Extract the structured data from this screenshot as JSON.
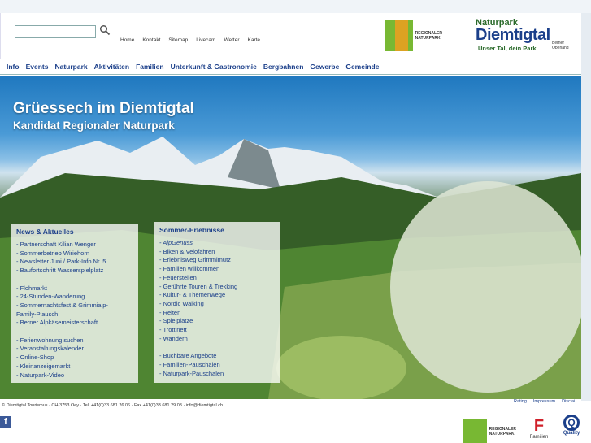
{
  "search": {
    "placeholder": ""
  },
  "topnav": [
    "Home",
    "Kontakt",
    "Sitemap",
    "Livecam",
    "Wetter",
    "Karte"
  ],
  "logos": {
    "regional": [
      "SCHWEIZER",
      "PARKS",
      "REGIONALER",
      "NATURPARK"
    ],
    "diemtigtal": {
      "prefix": "Naturpark",
      "name": "Diemtigtal",
      "tagline": "Unser Tal, dein Park.",
      "region": "Berner Oberland"
    },
    "familien": {
      "letter": "F",
      "label": "Familien"
    },
    "quality": {
      "letter": "Q",
      "label": "Quality"
    }
  },
  "mainnav": [
    "Info",
    "Events",
    "Naturpark",
    "Aktivitäten",
    "Familien",
    "Unterkunft & Gastronomie",
    "Bergbahnen",
    "Gewerbe",
    "Gemeinde"
  ],
  "hero": {
    "title": "Grüessech im Diemtigtal",
    "subtitle": "Kandidat Regionaler Naturpark"
  },
  "news": {
    "title": "News & Aktuelles",
    "groups": [
      [
        "- Partnerschaft Kilian Wenger",
        "- Sommerbetrieb Wiriehorn",
        "- Newsletter Juni / Park-Info Nr. 5",
        "- Baufortschritt Wasserspielplatz"
      ],
      [
        "- Flohmarkt",
        "- 24-Stunden-Wanderung",
        "- Sommernachtsfest & Grimmialp-",
        "  Family-Plausch",
        "- Berner Alpkäsemeisterschaft"
      ],
      [
        "- Ferienwohnung suchen",
        "- Veranstaltungskalender",
        "- Online-Shop",
        "- Kleinanzeigemarkt",
        "- Naturpark-Video"
      ]
    ]
  },
  "summer": {
    "title": "Sommer-Erlebnisse",
    "groups": [
      [
        "- AlpGenuss",
        "- Biken & Velofahren",
        "- Erlebnisweg Grimmimutz",
        "- Familien willkommen",
        "- Feuerstellen",
        "- Geführte Touren & Trekking",
        "- Kultur- & Themenwege",
        "- Nordic Walking",
        "- Reiten",
        "- Spielplätze",
        "- Trottinett",
        "- Wandern"
      ],
      [
        "- Buchbare Angebote",
        "- Familien-Pauschalen",
        "- Naturpark-Pauschalen"
      ]
    ]
  },
  "footer": {
    "text": "© Diemtigtal Tourismus · CH-3753 Oey · Tel. +41(0)33 681 26 06 · Fax +41(0)33 681 29 08 · info@diemtigtal.ch",
    "links": [
      "Rating",
      "Impressum",
      "Disclai"
    ]
  },
  "facebook": {
    "letter": "f"
  }
}
